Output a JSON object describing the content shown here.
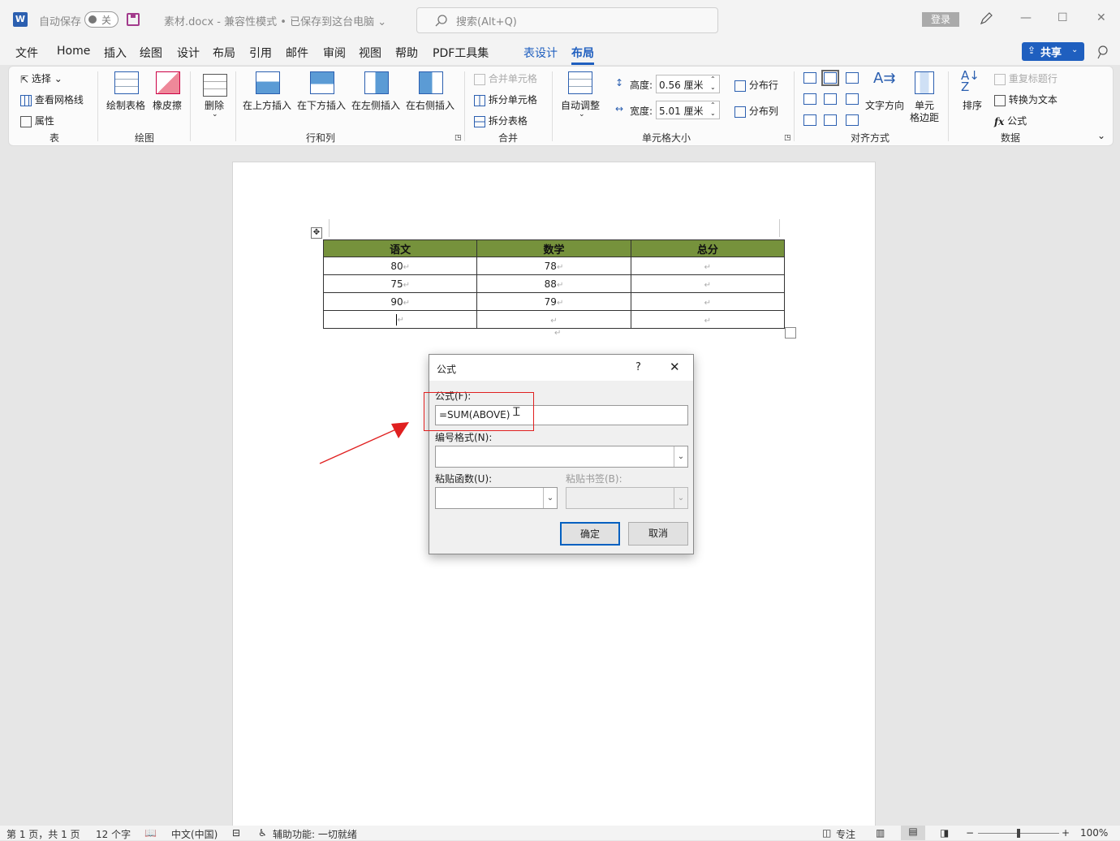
{
  "titlebar": {
    "autosave_label": "自动保存",
    "autosave_state": "关",
    "doc_title": "素材.docx  -  兼容性模式 • 已保存到这台电脑 ⌄",
    "search_placeholder": "搜索(Alt+Q)",
    "login_label": "登录"
  },
  "menu": {
    "file": "文件",
    "home": "Home",
    "insert": "插入",
    "draw": "绘图",
    "design": "设计",
    "layout": "布局",
    "references": "引用",
    "mailings": "邮件",
    "review": "审阅",
    "view": "视图",
    "help": "帮助",
    "pdf": "PDF工具集",
    "table_design": "表设计",
    "table_layout": "布局",
    "share": "共享"
  },
  "ribbon": {
    "table_group": {
      "select": "选择 ⌄",
      "gridlines": "查看网格线",
      "properties": "属性",
      "label": "表"
    },
    "draw_group": {
      "draw_table": "绘制表格",
      "eraser": "橡皮擦",
      "label": "绘图"
    },
    "rows_cols_group": {
      "delete": "删除",
      "insert_above": "在上方插入",
      "insert_below": "在下方插入",
      "insert_left": "在左侧插入",
      "insert_right": "在右侧插入",
      "label": "行和列"
    },
    "merge_group": {
      "merge_cells": "合并单元格",
      "split_cells": "拆分单元格",
      "split_table": "拆分表格",
      "label": "合并"
    },
    "cell_size_group": {
      "autofit": "自动调整",
      "height_label": "高度:",
      "height_value": "0.56 厘米",
      "width_label": "宽度:",
      "width_value": "5.01 厘米",
      "dist_rows": "分布行",
      "dist_cols": "分布列",
      "label": "单元格大小"
    },
    "alignment_group": {
      "text_direction": "文字方向",
      "cell_margins_1": "单元",
      "cell_margins_2": "格边距",
      "label": "对齐方式"
    },
    "data_group": {
      "sort": "排序",
      "repeat_header": "重复标题行",
      "convert_to_text": "转换为文本",
      "formula": "公式",
      "label": "数据"
    }
  },
  "document_table": {
    "headers": [
      "语文",
      "数学",
      "总分"
    ],
    "rows": [
      [
        "80",
        "78",
        ""
      ],
      [
        "75",
        "88",
        ""
      ],
      [
        "90",
        "79",
        ""
      ],
      [
        "",
        "",
        ""
      ]
    ]
  },
  "dialog": {
    "title": "公式",
    "help": "?",
    "formula_label": "公式(F):",
    "formula_value": "=SUM(ABOVE)",
    "number_format_label": "编号格式(N):",
    "number_format_value": "",
    "paste_function_label": "粘贴函数(U):",
    "paste_bookmark_label": "粘贴书签(B):",
    "ok": "确定",
    "cancel": "取消"
  },
  "status": {
    "page": "第 1 页，共 1 页",
    "words": "12 个字",
    "language": "中文(中国)",
    "accessibility": "辅助功能: 一切就绪",
    "focus": "专注",
    "zoom": "100%"
  },
  "colors": {
    "accent": "#1f5fbf",
    "table_header": "#76923c",
    "annotation": "#e02020"
  }
}
